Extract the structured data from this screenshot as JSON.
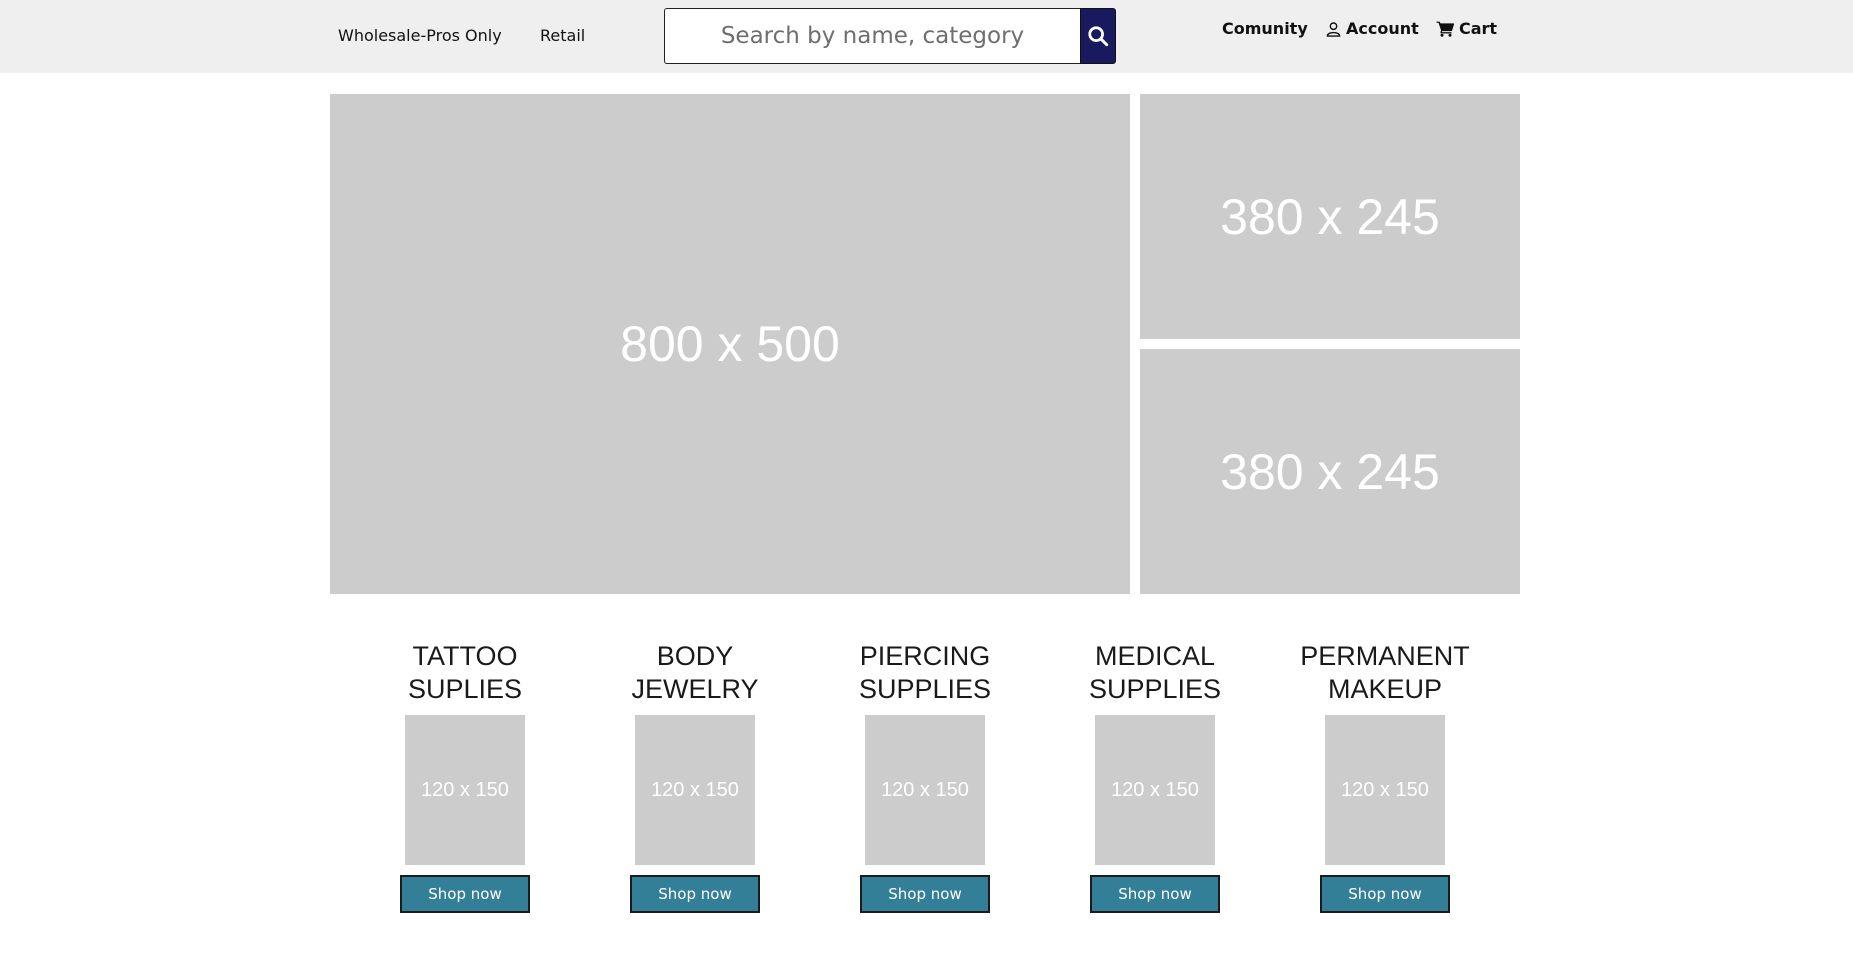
{
  "header": {
    "nav": [
      {
        "label": "Wholesale-Pros Only"
      },
      {
        "label": "Retail"
      }
    ],
    "search": {
      "placeholder": "Search by name, category",
      "value": "",
      "icon": "search-icon"
    },
    "utility": {
      "community_label": "Comunity",
      "account_label": "Account",
      "account_icon": "user-icon",
      "cart_label": "Cart",
      "cart_icon": "cart-icon"
    }
  },
  "hero": {
    "main_label": "800 x 500",
    "side": [
      {
        "label": "380 x 245"
      },
      {
        "label": "380 x 245"
      }
    ]
  },
  "categories": [
    {
      "title_line1": "TATTOO",
      "title_line2": "SUPLIES",
      "image_label": "120 x 150",
      "button_label": "Shop now"
    },
    {
      "title_line1": "BODY",
      "title_line2": "JEWELRY",
      "image_label": "120 x 150",
      "button_label": "Shop now"
    },
    {
      "title_line1": "PIERCING",
      "title_line2": "SUPPLIES",
      "image_label": "120 x 150",
      "button_label": "Shop now"
    },
    {
      "title_line1": "MEDICAL",
      "title_line2": "SUPPLIES",
      "image_label": "120 x 150",
      "button_label": "Shop now"
    },
    {
      "title_line1": "PERMANENT",
      "title_line2": "MAKEUP",
      "image_label": "120 x 150",
      "button_label": "Shop now"
    }
  ],
  "colors": {
    "topbar_bg": "#efefef",
    "search_button": "#18195e",
    "shop_button": "#347f98",
    "placeholder_gray": "#cccccc"
  }
}
